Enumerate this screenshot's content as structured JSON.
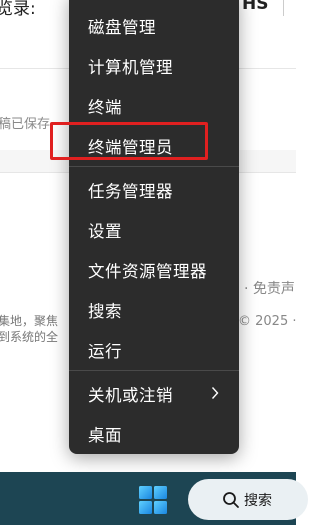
{
  "background": {
    "top_left_text": "览录:",
    "top_right_text": "HS",
    "draft_text": "稿已保存",
    "right_text_1": "· 免责声",
    "right_text_2": "© 2025 ·",
    "left_text_1": "集地，聚焦",
    "left_text_2": "到系统的全"
  },
  "menu": {
    "items": [
      {
        "label": "磁盘管理"
      },
      {
        "label": "计算机管理"
      },
      {
        "label": "终端"
      },
      {
        "label": "终端管理员"
      },
      {
        "label": "任务管理器"
      },
      {
        "label": "设置"
      },
      {
        "label": "文件资源管理器"
      },
      {
        "label": "搜索"
      },
      {
        "label": "运行"
      },
      {
        "label": "关机或注销"
      },
      {
        "label": "桌面"
      }
    ]
  },
  "taskbar": {
    "search_label": "搜索"
  },
  "colors": {
    "menu_bg": "#2c2c2c",
    "highlight": "#e02020",
    "taskbar_bg": "#1d4553",
    "start_blue": "#2aa8f0"
  }
}
